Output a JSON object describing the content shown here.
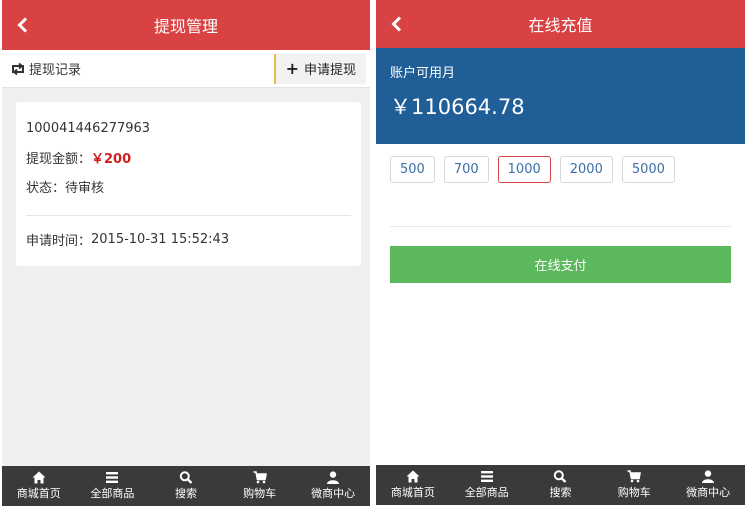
{
  "left": {
    "header": {
      "title": "提现管理"
    },
    "toolbar": {
      "records_label": "提现记录",
      "apply_label": "申请提现",
      "apply_plus": "+"
    },
    "record": {
      "id": "100041446277963",
      "amount_label": "提现金额：",
      "amount_value": "￥200",
      "status_label": "状态：",
      "status_value": "待审核",
      "time_label": "申请时间：",
      "time_value": "2015-10-31 15:52:43"
    }
  },
  "right": {
    "header": {
      "title": "在线充值"
    },
    "balance": {
      "label": "账户可用月",
      "amount": "￥110664.78"
    },
    "amounts": [
      {
        "label": "500",
        "selected": false
      },
      {
        "label": "700",
        "selected": false
      },
      {
        "label": "1000",
        "selected": true
      },
      {
        "label": "2000",
        "selected": false
      },
      {
        "label": "5000",
        "selected": false
      }
    ],
    "pay_label": "在线支付"
  },
  "footer": {
    "items": [
      {
        "label": "商城首页",
        "icon": "home-icon"
      },
      {
        "label": "全部商品",
        "icon": "menu-icon"
      },
      {
        "label": "搜索",
        "icon": "search-icon"
      },
      {
        "label": "购物车",
        "icon": "cart-icon"
      },
      {
        "label": "微商中心",
        "icon": "user-icon"
      }
    ]
  },
  "colors": {
    "header_red": "#d94242",
    "balance_blue": "#1f5e97",
    "pay_green": "#5cb85c",
    "footer_dark": "#3b3a3b",
    "amount_red": "#d01f1f"
  }
}
